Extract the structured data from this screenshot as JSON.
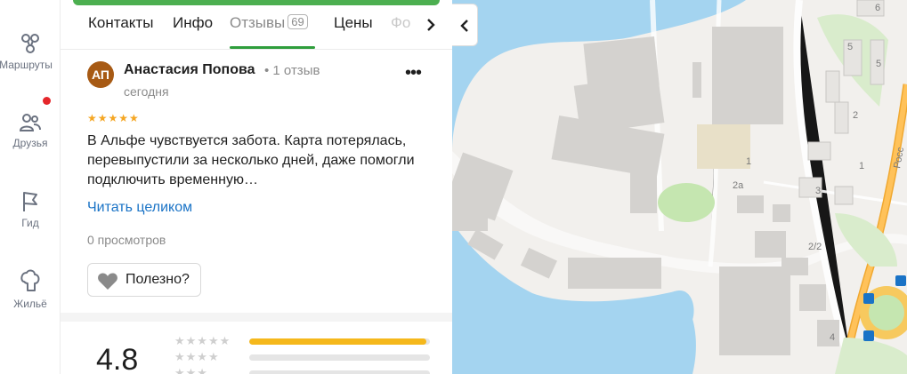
{
  "rail": {
    "routes": "Маршруты",
    "friends": "Друзья",
    "guide": "Гид",
    "housing": "Жильё"
  },
  "tabs": {
    "contacts": "Контакты",
    "info": "Инфо",
    "reviews": "Отзывы",
    "reviews_count": "69",
    "prices": "Цены",
    "next_partial": "Фо"
  },
  "review": {
    "avatar_initials": "АП",
    "author": "Анастасия Попова",
    "author_meta": "• 1 отзыв",
    "date": "сегодня",
    "rating": 5,
    "text": "В Альфе чувствуется забота. Карта потерялась, перевыпустили за несколько дней, даже помогли подключить временную…",
    "read_more": "Читать целиком",
    "views": "0 просмотров",
    "useful": "Полезно?"
  },
  "summary": {
    "average": "4.8",
    "distribution": [
      {
        "stars": 5,
        "fraction": 0.98
      },
      {
        "stars": 4,
        "fraction": 0.0
      },
      {
        "stars": 3,
        "fraction": 0.0
      }
    ]
  },
  "map": {
    "labels": [
      "6",
      "5",
      "5",
      "2",
      "1",
      "3",
      "2a",
      "2/2",
      "4",
      "1",
      "Росс"
    ]
  },
  "colors": {
    "accent_green": "#2e9e3c",
    "link_blue": "#1a73c6",
    "star_yellow": "#f5a623",
    "avatar": "#a75a14",
    "water": "#a4d4f0",
    "notification": "#e5262b"
  }
}
